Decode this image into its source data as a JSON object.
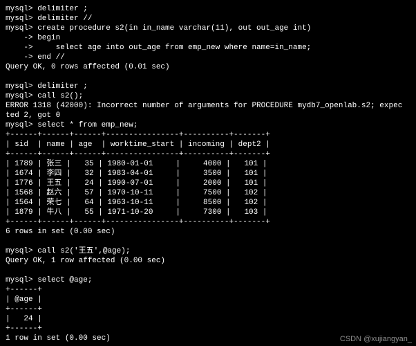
{
  "lines": {
    "l00": "mysql> delimiter ;",
    "l01": "mysql> delimiter //",
    "l02": "mysql> create procedure s2(in in_name varchar(11), out out_age int)",
    "l03": "    -> begin",
    "l04": "    ->     select age into out_age from emp_new where name=in_name;",
    "l05": "    -> end //",
    "l06": "Query OK, 0 rows affected (0.01 sec)",
    "l07": "",
    "l08": "mysql> delimiter ;",
    "l09": "mysql> call s2();",
    "l10": "ERROR 1318 (42000): Incorrect number of arguments for PROCEDURE mydb7_openlab.s2; expec",
    "l11": "ted 2, got 0",
    "l12": "mysql> select * from emp_new;"
  },
  "table_emp": {
    "border": "+------+------+------+----------------+----------+-------+",
    "header": "| sid  | name | age  | worktime_start | incoming | dept2 |",
    "rows": [
      "| 1789 | 张三 |   35 | 1980-01-01     |     4000 |   101 |",
      "| 1674 | 李四 |   32 | 1983-04-01     |     3500 |   101 |",
      "| 1776 | 王五 |   24 | 1990-07-01     |     2000 |   101 |",
      "| 1568 | 赵六 |   57 | 1970-10-11     |     7500 |   102 |",
      "| 1564 | 荣七 |   64 | 1963-10-11     |     8500 |   102 |",
      "| 1879 | 牛八 |   55 | 1971-10-20     |     7300 |   103 |"
    ],
    "footer": "6 rows in set (0.00 sec)"
  },
  "call2": {
    "l0": "mysql> call s2('王五',@age);",
    "l1": "Query OK, 1 row affected (0.00 sec)",
    "l2": "",
    "l3": "mysql> select @age;"
  },
  "table_age": {
    "border": "+------+",
    "header": "| @age |",
    "row": "|   24 |",
    "footer": "1 row in set (0.00 sec)"
  },
  "watermark": "CSDN @xujiangyan_",
  "chart_data": {
    "type": "table",
    "title": "emp_new",
    "columns": [
      "sid",
      "name",
      "age",
      "worktime_start",
      "incoming",
      "dept2"
    ],
    "rows": [
      [
        1789,
        "张三",
        35,
        "1980-01-01",
        4000,
        101
      ],
      [
        1674,
        "李四",
        32,
        "1983-04-01",
        3500,
        101
      ],
      [
        1776,
        "王五",
        24,
        "1990-07-01",
        2000,
        101
      ],
      [
        1568,
        "赵六",
        57,
        "1970-10-11",
        7500,
        102
      ],
      [
        1564,
        "荣七",
        64,
        "1963-10-11",
        8500,
        102
      ],
      [
        1879,
        "牛八",
        55,
        "1971-10-20",
        7300,
        103
      ]
    ]
  }
}
